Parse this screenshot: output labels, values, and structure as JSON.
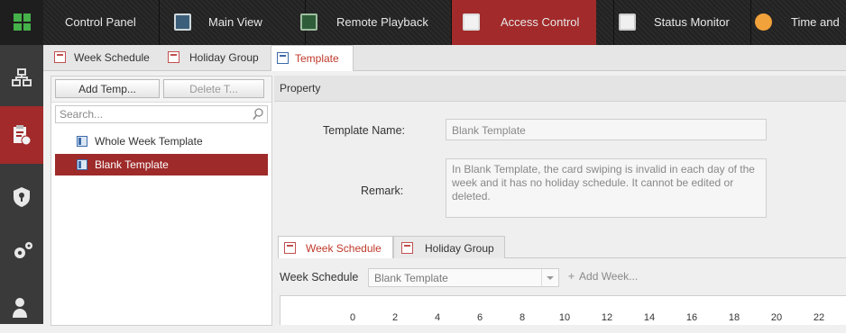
{
  "topbar": {
    "tabs": [
      {
        "label": "Control Panel",
        "icon": "control-panel-icon"
      },
      {
        "label": "Main View",
        "icon": "main-view-icon"
      },
      {
        "label": "Remote Playback",
        "icon": "remote-playback-icon"
      },
      {
        "label": "Access Control",
        "icon": "access-control-icon",
        "active": true
      },
      {
        "label": "Status Monitor",
        "icon": "status-monitor-icon"
      },
      {
        "label": "Time and",
        "icon": "time-attendance-icon"
      }
    ]
  },
  "rail": {
    "items": [
      {
        "icon": "device-tree-icon"
      },
      {
        "icon": "schedule-icon",
        "active": true
      },
      {
        "icon": "shield-icon"
      },
      {
        "icon": "settings-icon"
      },
      {
        "icon": "person-icon"
      }
    ]
  },
  "subtabs": [
    {
      "label": "Week Schedule"
    },
    {
      "label": "Holiday Group"
    },
    {
      "label": "Template",
      "active": true
    }
  ],
  "left_panel": {
    "add_button": "Add Temp...",
    "delete_button": "Delete T...",
    "search_placeholder": "Search...",
    "templates": [
      {
        "label": "Whole Week Template",
        "selected": false
      },
      {
        "label": "Blank Template",
        "selected": true
      }
    ]
  },
  "property": {
    "header": "Property",
    "template_name_label": "Template Name:",
    "template_name_value": "Blank Template",
    "remark_label": "Remark:",
    "remark_value": "In Blank Template, the card swiping is invalid in each day of the week and it has no holiday schedule. It cannot be edited or deleted."
  },
  "schedule_tabs": [
    {
      "label": "Week Schedule",
      "active": true
    },
    {
      "label": "Holiday Group",
      "active": false
    }
  ],
  "week_schedule": {
    "label": "Week Schedule",
    "selected": "Blank Template",
    "add_week": "Add Week..."
  },
  "timeline": {
    "ticks": [
      "0",
      "2",
      "4",
      "6",
      "8",
      "10",
      "12",
      "14",
      "16",
      "18",
      "20",
      "22"
    ]
  },
  "colors": {
    "accent_red": "#a22a2a",
    "topbar_bg": "#262626",
    "rail_bg": "#3a3a3a"
  }
}
